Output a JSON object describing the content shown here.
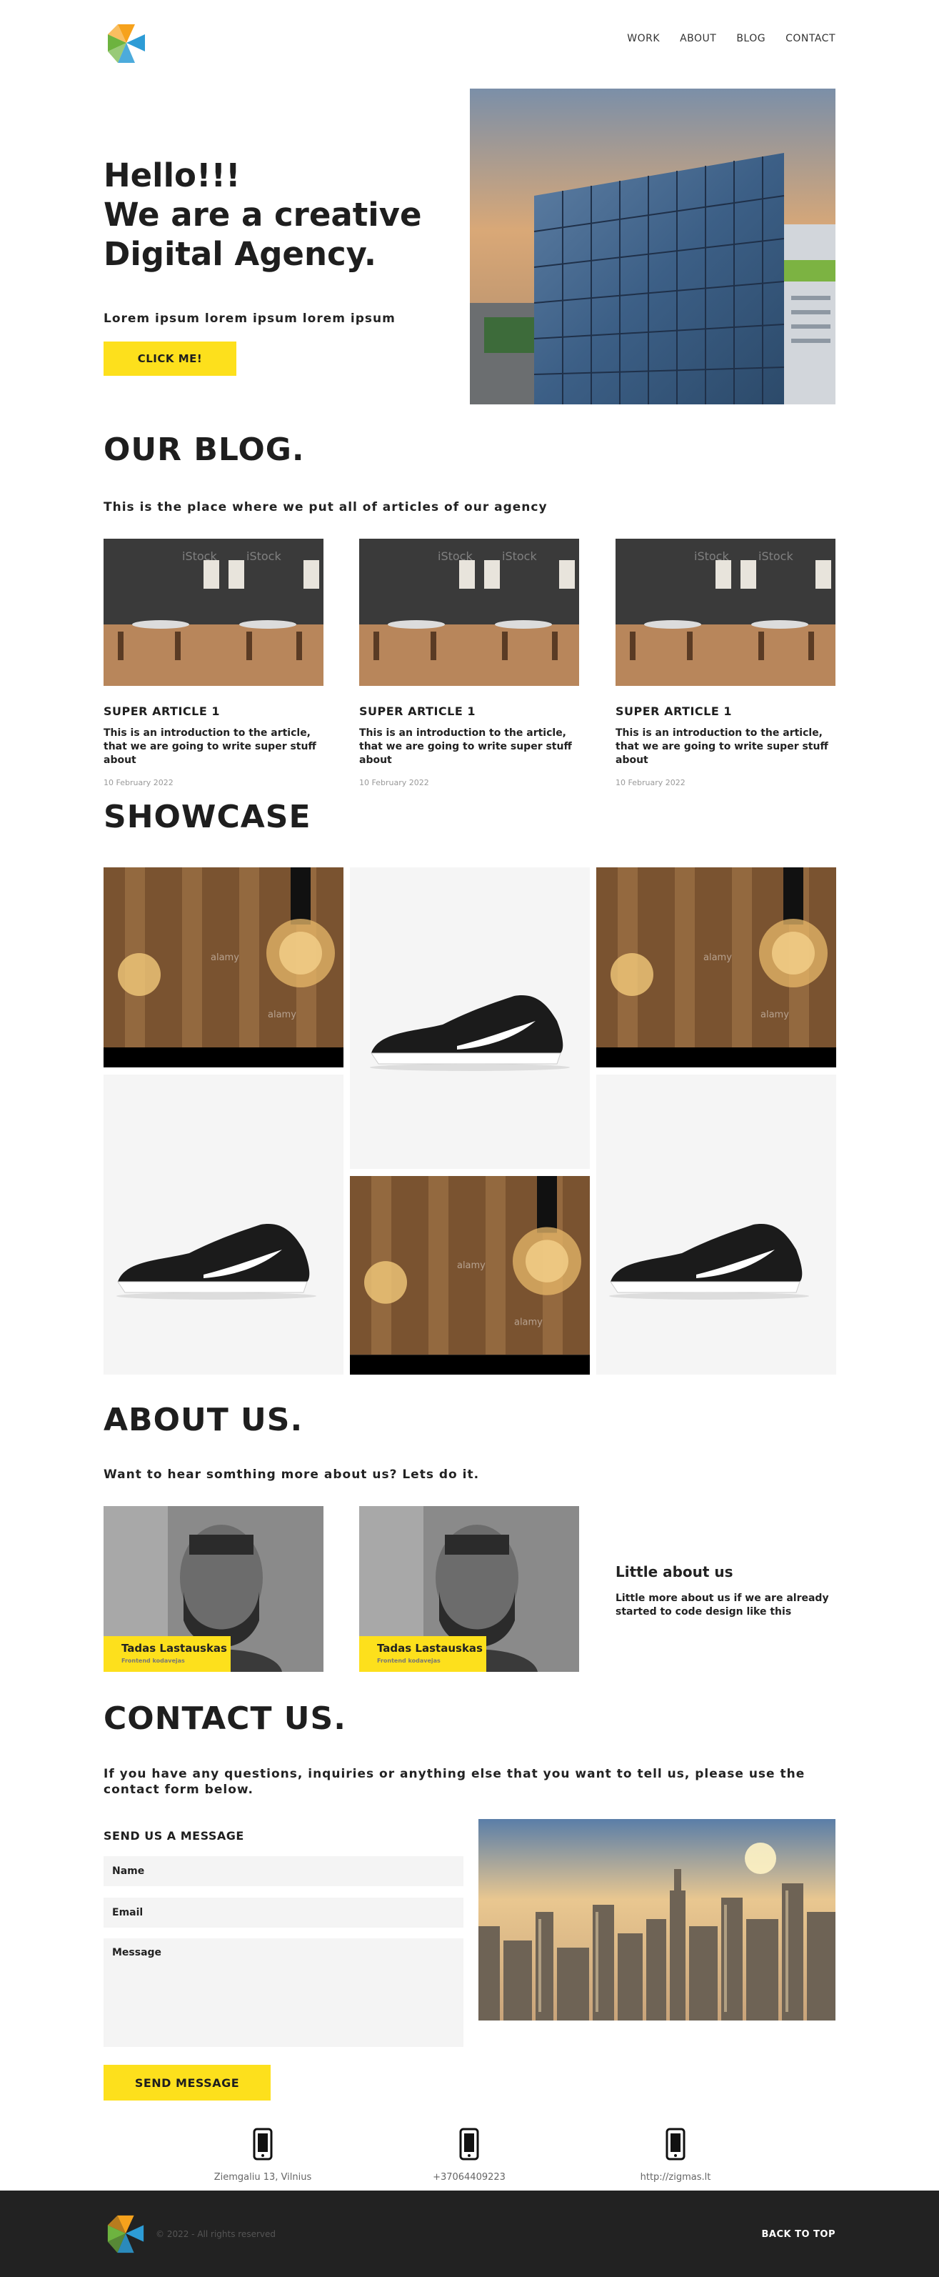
{
  "nav": {
    "items": [
      "WORK",
      "ABOUT",
      "BLOG",
      "CONTACT"
    ]
  },
  "hero": {
    "title_lines": [
      "Hello!!!",
      "We are a creative",
      "Digital Agency."
    ],
    "subtitle": "Lorem ipsum lorem ipsum lorem ipsum",
    "button": "CLICK ME!"
  },
  "blog": {
    "title": "OUR BLOG.",
    "lead": "This is the place where we put all of articles of our agency",
    "articles": [
      {
        "title": "SUPER ARTICLE 1",
        "intro": "This is an introduction to the article, that we are going to write super stuff about",
        "date": "10 February 2022"
      },
      {
        "title": "SUPER ARTICLE 1",
        "intro": "This is an introduction to the article, that we are going to write super stuff about",
        "date": "10 February 2022"
      },
      {
        "title": "SUPER ARTICLE 1",
        "intro": "This is an introduction to the article, that we are going to write super stuff about",
        "date": "10 February 2022"
      }
    ],
    "watermark": "iStock"
  },
  "showcase": {
    "title": "SHOWCASE",
    "watermark": "alamy"
  },
  "about": {
    "title": "ABOUT US.",
    "lead": "Want to hear somthing more about us? Lets do it.",
    "people": [
      {
        "name": "Tadas Lastauskas",
        "role": "Frontend kodavejas"
      },
      {
        "name": "Tadas Lastauskas",
        "role": "Frontend kodavejas"
      }
    ],
    "side_title": "Little about us",
    "side_text": "Little more about us if we are already started to code design like this"
  },
  "contact": {
    "title": "CONTACT US.",
    "lead": "If you have any questions, inquiries or anything else that you want to tell us, please use the contact form below.",
    "form_title": "SEND US A MESSAGE",
    "name_placeholder": "Name",
    "email_placeholder": "Email",
    "message_placeholder": "Message",
    "send": "SEND MESSAGE",
    "info": [
      "Ziemgaliu 13, Vilnius",
      "+37064409223",
      "http://zigmas.lt"
    ]
  },
  "footer": {
    "copy": "© 2022 - All rights reserved",
    "back_to_top": "BACK TO TOP"
  },
  "colors": {
    "accent": "#fde01c",
    "dark": "#222222",
    "text": "#1e1e1e"
  }
}
